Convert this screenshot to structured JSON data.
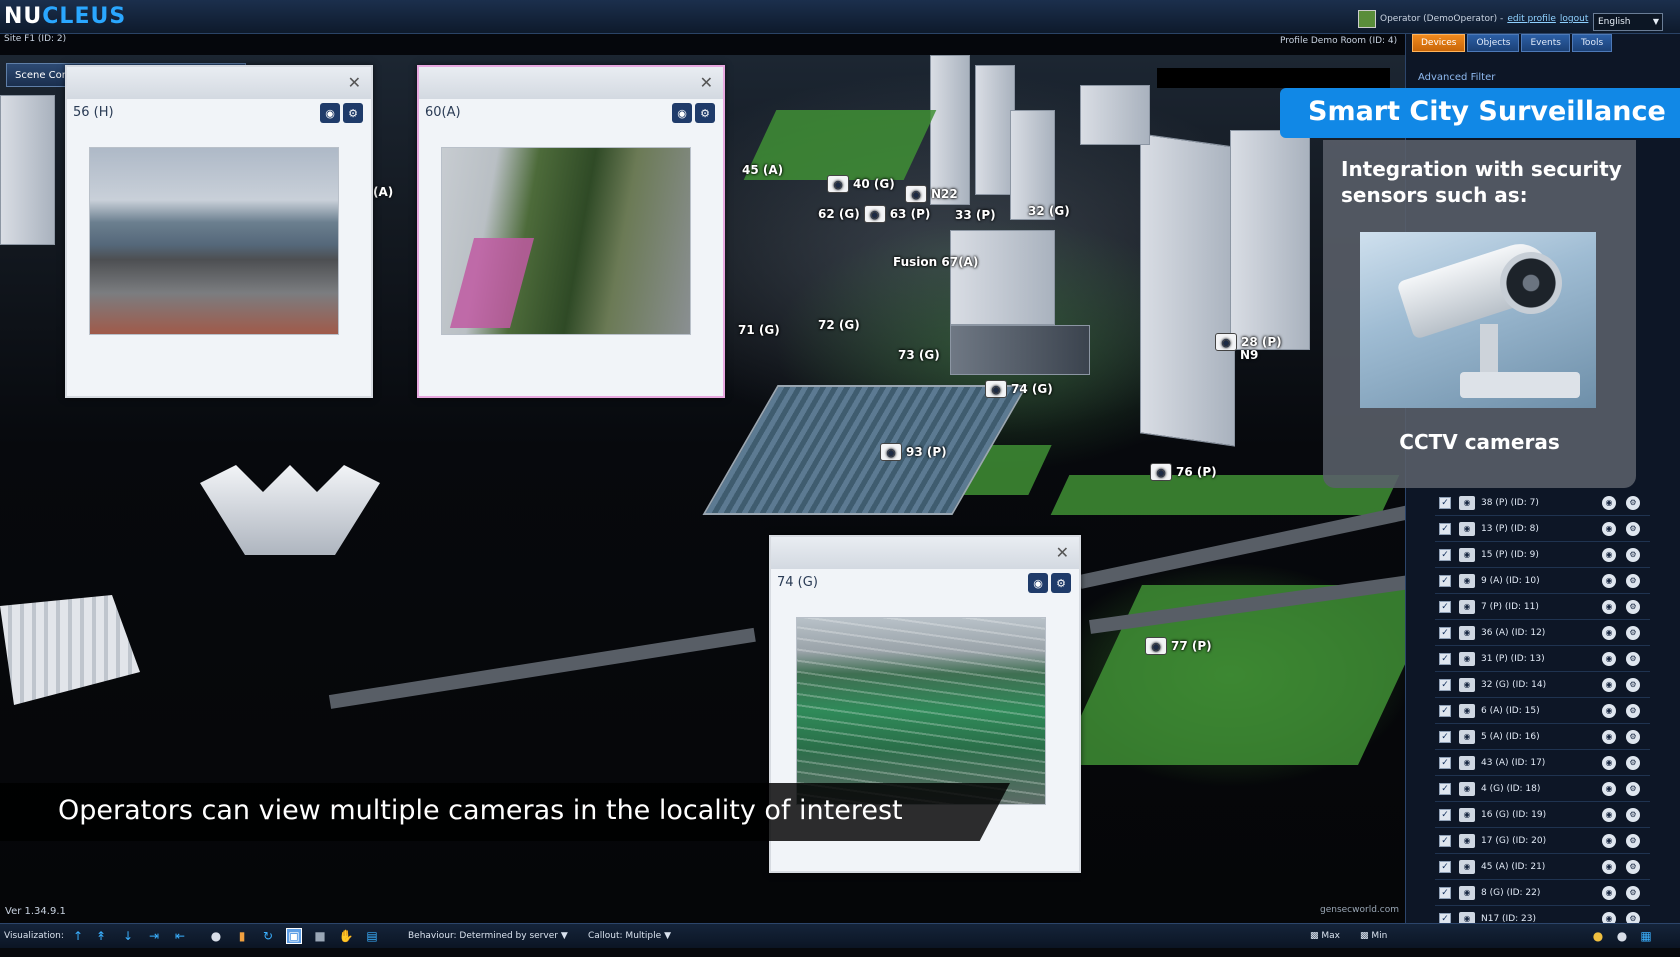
{
  "app": {
    "logo_a": "NU",
    "logo_b": "CLEUS",
    "site": "Site F1 (ID: 2)",
    "profile_room": "Profile Demo Room (ID: 4)",
    "version": "Ver 1.34.9.1",
    "watermark": "gensecworld.com"
  },
  "user": {
    "operator": "Operator (DemoOperator) -",
    "edit_profile": "edit profile",
    "logout": "logout",
    "language": "English"
  },
  "scene_control": {
    "label": "Scene Control"
  },
  "right_panel": {
    "tabs": [
      "Devices",
      "Objects",
      "Events",
      "Tools"
    ],
    "advanced_filter": "Advanced Filter",
    "devices": [
      "38 (P) (ID: 7)",
      "13 (P) (ID: 8)",
      "15 (P) (ID: 9)",
      "9 (A) (ID: 10)",
      "7 (P) (ID: 11)",
      "36 (A) (ID: 12)",
      "31 (P) (ID: 13)",
      "32 (G) (ID: 14)",
      "6 (A) (ID: 15)",
      "5 (A) (ID: 16)",
      "43 (A) (ID: 17)",
      "4 (G) (ID: 18)",
      "16 (G) (ID: 19)",
      "17 (G) (ID: 20)",
      "45 (A) (ID: 21)",
      "8 (G) (ID: 22)",
      "N17 (ID: 23)"
    ]
  },
  "camera_windows": [
    {
      "name": "56 (H)"
    },
    {
      "name": "60(A)"
    },
    {
      "name": "74 (G)"
    }
  ],
  "map_markers": {
    "m45": "45 (A)",
    "m40": "40 (G)",
    "m62": "62 (G)",
    "m63": "63 (P)",
    "mN22": "N22",
    "m33": "33 (P)",
    "m32": "32 (G)",
    "fusion": "Fusion 67(A)",
    "m71": "71 (G)",
    "m72": "72 (G)",
    "m73": "73 (G)",
    "m74": "74 (G)",
    "m28": "28 (P)",
    "mN9": "N9",
    "m93": "93 (P)",
    "m76": "76 (P)",
    "m77": "77 (P)",
    "mA": "(A)"
  },
  "overlay": {
    "banner": "Smart City Surveillance",
    "subtitle": "Integration with security sensors such as:",
    "caption": "CCTV cameras"
  },
  "caption_bar": "Operators can view multiple cameras in the locality of interest",
  "bottom_bar": {
    "visualization": "Visualization:",
    "behaviour": "Behaviour: Determined by server",
    "callout": "Callout: Multiple",
    "max": "Max",
    "min": "Min"
  },
  "colors": {
    "brand_blue": "#2aa7ff",
    "banner_blue": "#1188e6",
    "active_tab": "#f08a1e"
  }
}
